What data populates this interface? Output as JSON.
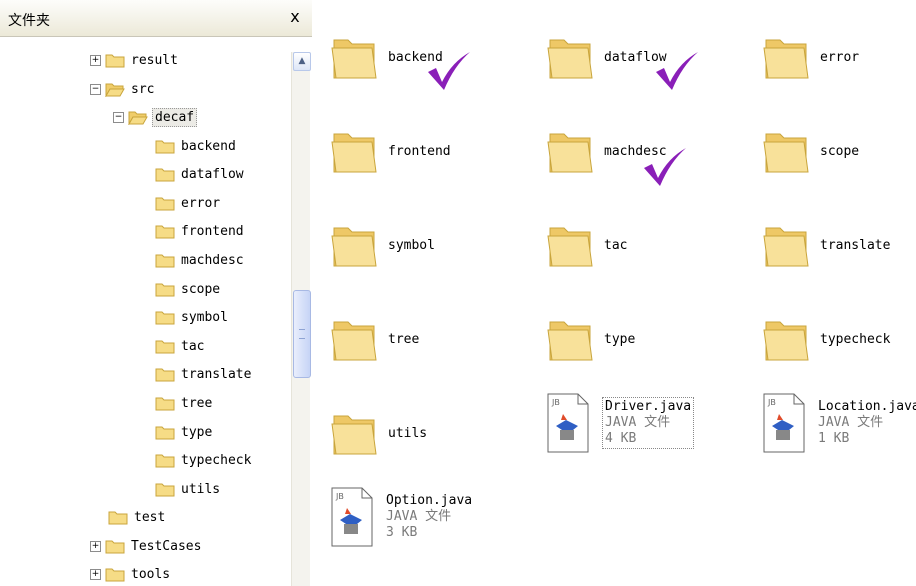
{
  "folder_pane": {
    "title": "文件夹",
    "close_label": "x",
    "tree": [
      {
        "label": "result",
        "expander": "+"
      },
      {
        "label": "src",
        "expander": "−"
      },
      {
        "label": "decaf",
        "expander": "−"
      },
      {
        "label": "backend"
      },
      {
        "label": "dataflow"
      },
      {
        "label": "error"
      },
      {
        "label": "frontend"
      },
      {
        "label": "machdesc"
      },
      {
        "label": "scope"
      },
      {
        "label": "symbol"
      },
      {
        "label": "tac"
      },
      {
        "label": "translate"
      },
      {
        "label": "tree"
      },
      {
        "label": "type"
      },
      {
        "label": "typecheck"
      },
      {
        "label": "utils"
      },
      {
        "label": "test"
      },
      {
        "label": "TestCases",
        "expander": "+"
      },
      {
        "label": "tools",
        "expander": "+"
      }
    ],
    "scroll_up_glyph": "▲"
  },
  "file_view": {
    "folders": [
      {
        "label": "backend",
        "checked": true
      },
      {
        "label": "dataflow",
        "checked": true
      },
      {
        "label": "error"
      },
      {
        "label": "frontend"
      },
      {
        "label": "machdesc",
        "checked": true
      },
      {
        "label": "scope"
      },
      {
        "label": "symbol"
      },
      {
        "label": "tac"
      },
      {
        "label": "translate"
      },
      {
        "label": "tree"
      },
      {
        "label": "type"
      },
      {
        "label": "typecheck"
      },
      {
        "label": "utils"
      }
    ],
    "files": [
      {
        "name": "Driver.java",
        "type": "JAVA 文件",
        "size": "4 KB",
        "badge": "JB"
      },
      {
        "name": "Location.java",
        "type": "JAVA 文件",
        "size": "1 KB",
        "badge": "JB"
      },
      {
        "name": "Option.java",
        "type": "JAVA 文件",
        "size": "3 KB",
        "badge": "JB"
      }
    ]
  },
  "colors": {
    "folder_fill": "#f6dc86",
    "folder_edge": "#c9a53c",
    "checkmark": "#8a1fb8",
    "header_bg": "#ece9d8"
  }
}
